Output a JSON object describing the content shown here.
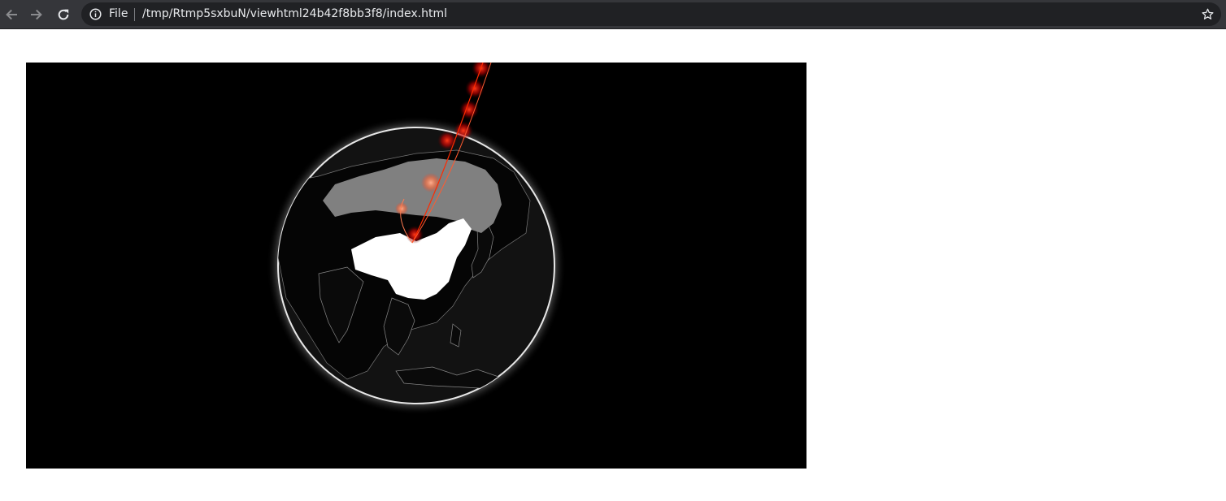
{
  "browser": {
    "nav": {
      "back_icon": "arrow-left-icon",
      "forward_icon": "arrow-right-icon",
      "reload_icon": "reload-icon"
    },
    "omnibox": {
      "security_icon": "info-circle-icon",
      "scheme_label": "File",
      "url": "/tmp/Rtmp5sxbuN/viewhtml24b42f8bb3f8/index.html",
      "bookmark_icon": "star-icon"
    },
    "colors": {
      "toolbar_bg": "#35363a",
      "omnibox_bg": "#202124",
      "text": "#e8eaed"
    }
  },
  "page": {
    "widget": {
      "type": "3d-globe",
      "background": "#000000",
      "globe_color": "#141414",
      "highlight_countries": [
        {
          "name": "China",
          "color": "#ffffff"
        },
        {
          "name": "Russia",
          "color": "#808080"
        }
      ],
      "arc_color": "#ff2a00",
      "point_color": "#ff0000"
    }
  }
}
